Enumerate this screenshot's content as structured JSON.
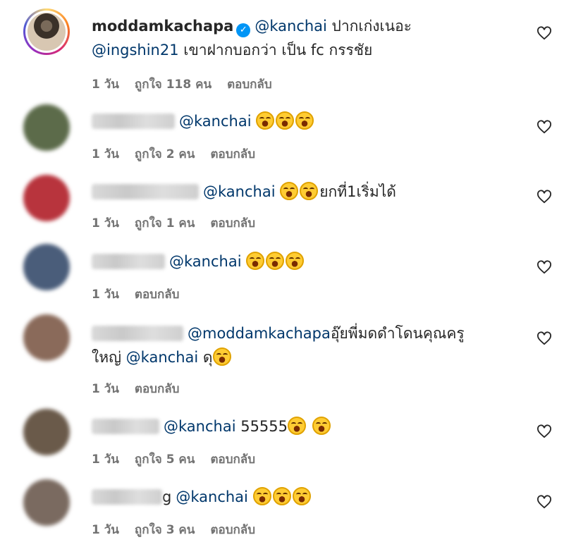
{
  "comments": [
    {
      "username": "moddamkachapa",
      "verified": true,
      "line1": "@kanchai ปากเก่งเนอะ",
      "mention1": "@kanchai",
      "text1": " ปากเก่งเนอะ",
      "mention2": "@ingshin21",
      "text2": " เขาฝากบอกว่า เป็น fc กรรชัย",
      "time": "1 วัน",
      "likes": "ถูกใจ 118 คน",
      "reply": "ตอบกลับ"
    },
    {
      "mention": "@kanchai",
      "text": "",
      "emoji_count": 3,
      "time": "1 วัน",
      "likes": "ถูกใจ 2 คน",
      "reply": "ตอบกลับ",
      "avatar_color": "#5c6b4a"
    },
    {
      "mention": "@kanchai",
      "text": "ยกที่1เริ่มได้",
      "emoji_count": 2,
      "time": "1 วัน",
      "likes": "ถูกใจ 1 คน",
      "reply": "ตอบกลับ",
      "avatar_color": "#b8343d"
    },
    {
      "mention": "@kanchai",
      "text": "",
      "emoji_count": 3,
      "time": "1 วัน",
      "reply": "ตอบกลับ",
      "avatar_color": "#4a5d7a"
    },
    {
      "mention": "@moddamkachapa",
      "text": "อุ๊ยพี่มดดำโดนคุณครู",
      "text_line2": "ใหญ่ ",
      "mention2": "@kanchai",
      "text_after": " ดุ",
      "time": "1 วัน",
      "reply": "ตอบกลับ",
      "avatar_color": "#8a6a5a"
    },
    {
      "mention": "@kanchai",
      "text": " 55555",
      "emoji_count": 2,
      "time": "1 วัน",
      "likes": "ถูกใจ 5 คน",
      "reply": "ตอบกลับ",
      "avatar_color": "#6a5a4a"
    },
    {
      "name_tail": "g",
      "mention": "@kanchai",
      "text": "",
      "emoji_count": 3,
      "time": "1 วัน",
      "likes": "ถูกใจ 3 คน",
      "reply": "ตอบกลับ",
      "avatar_color": "#7a6a60"
    }
  ],
  "icons": {
    "heart": "heart-outline-icon",
    "emoji": "laughing-tears-emoji",
    "verified": "verified-badge-icon"
  }
}
